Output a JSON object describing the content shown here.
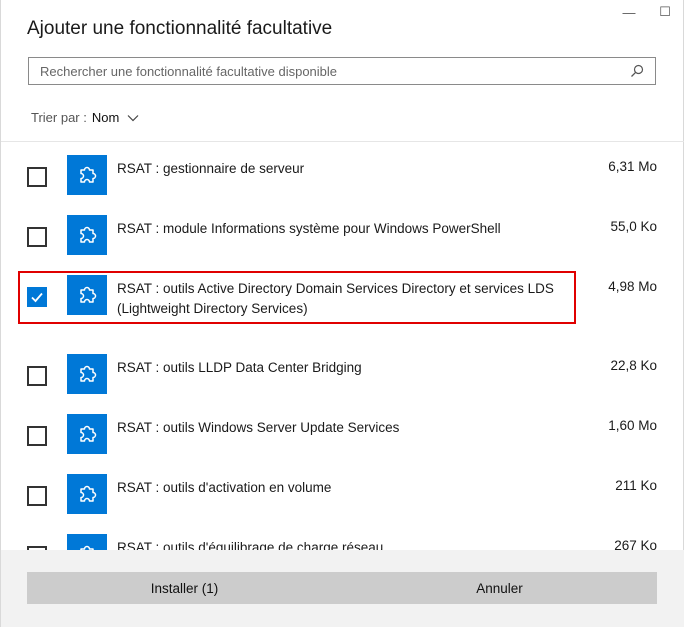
{
  "window": {
    "title": "Ajouter une fonctionnalité facultative",
    "minimize_glyph": "—",
    "maximize_glyph": "☐"
  },
  "search": {
    "placeholder": "Rechercher une fonctionnalité facultative disponible",
    "value": "",
    "icon": "search-icon"
  },
  "sort": {
    "label": "Trier par :",
    "value": "Nom",
    "icon": "chevron-down-icon"
  },
  "features": [
    {
      "name": "RSAT : gestionnaire de serveur",
      "size": "6,31 Mo",
      "checked": false
    },
    {
      "name": "RSAT : module Informations système pour Windows PowerShell",
      "size": "55,0 Ko",
      "checked": false
    },
    {
      "name": "RSAT : outils Active Directory Domain Services Directory et services LDS (Lightweight Directory Services)",
      "size": "4,98 Mo",
      "checked": true,
      "highlighted": true
    },
    {
      "name": "RSAT : outils LLDP Data Center Bridging",
      "size": "22,8 Ko",
      "checked": false
    },
    {
      "name": "RSAT : outils Windows Server Update Services",
      "size": "1,60 Mo",
      "checked": false
    },
    {
      "name": "RSAT : outils d'activation en volume",
      "size": "211 Ko",
      "checked": false
    },
    {
      "name": "RSAT : outils d'équilibrage de charge réseau",
      "size": "267 Ko",
      "checked": false
    }
  ],
  "footer": {
    "install_label": "Installer (1)",
    "cancel_label": "Annuler"
  },
  "colors": {
    "accent": "#0078d7",
    "highlight_border": "#e00000",
    "button_bg": "#cccccc",
    "footer_bg": "#f2f2f2"
  }
}
